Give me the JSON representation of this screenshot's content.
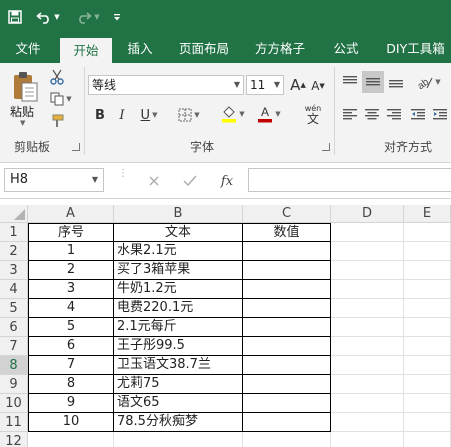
{
  "titlebar": {
    "save_icon": "save-icon",
    "undo_icon": "undo-icon",
    "redo_icon": "redo-icon",
    "customize_icon": "customize-qat-icon"
  },
  "tabs": [
    {
      "label": "文件",
      "active": false
    },
    {
      "label": "开始",
      "active": true
    },
    {
      "label": "插入",
      "active": false
    },
    {
      "label": "页面布局",
      "active": false
    },
    {
      "label": "方方格子",
      "active": false
    },
    {
      "label": "公式",
      "active": false
    },
    {
      "label": "DIY工具箱",
      "active": false
    }
  ],
  "ribbon": {
    "clipboard": {
      "paste_label": "粘贴",
      "group_label": "剪贴板"
    },
    "font": {
      "font_name": "等线",
      "font_size": "11",
      "group_label": "字体",
      "grow_label": "A",
      "shrink_label": "A",
      "bold": "B",
      "italic": "I",
      "underline": "U",
      "wen": "wén",
      "wen_char": "文"
    },
    "alignment": {
      "group_label": "对齐方式"
    }
  },
  "formula_bar": {
    "name_box": "H8",
    "fx": "fx",
    "formula": ""
  },
  "sheet": {
    "columns": [
      "A",
      "B",
      "C",
      "D",
      "E"
    ],
    "rows": [
      "1",
      "2",
      "3",
      "4",
      "5",
      "6",
      "7",
      "8",
      "9",
      "10",
      "11",
      "12"
    ],
    "selected_row": "8",
    "data": [
      [
        "序号",
        "文本",
        "数值"
      ],
      [
        "1",
        "水果2.1元",
        ""
      ],
      [
        "2",
        "买了3箱苹果",
        ""
      ],
      [
        "3",
        "牛奶1.2元",
        ""
      ],
      [
        "4",
        "电费220.1元",
        ""
      ],
      [
        "5",
        "2.1元每斤",
        ""
      ],
      [
        "6",
        "王子彤99.5",
        ""
      ],
      [
        "7",
        "卫玉语文38.7兰",
        ""
      ],
      [
        "8",
        "尤莉75",
        ""
      ],
      [
        "9",
        "语文65",
        ""
      ],
      [
        "10",
        "78.5分秋痴梦",
        ""
      ]
    ]
  },
  "colors": {
    "brand": "#217346",
    "font_color": "#c00000",
    "highlight": "#ffff00"
  }
}
